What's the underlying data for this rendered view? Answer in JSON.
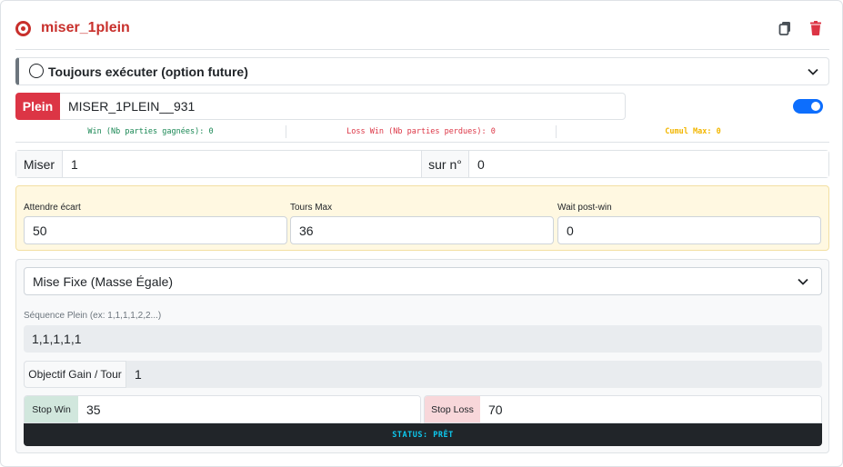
{
  "header": {
    "title": "miser_1plein",
    "title_color": "#c8302c"
  },
  "accordion": {
    "label": "Toujours exécuter (option future)"
  },
  "plein": {
    "badge_label": "Plein",
    "badge_color": "#dc3545",
    "value": "MISER_1PLEIN__931",
    "toggle_on": true
  },
  "stats": {
    "win": "Win (Nb parties gagnées): 0",
    "loss": "Loss Win (Nb parties perdues): 0",
    "cumul": "Cumul Max: 0"
  },
  "miser": {
    "label": "Miser",
    "value": "1",
    "sur_label": "sur n°",
    "sur_value": "0"
  },
  "params": {
    "attendre_label": "Attendre écart",
    "attendre_value": "50",
    "tours_label": "Tours Max",
    "tours_value": "36",
    "wait_label": "Wait post-win",
    "wait_value": "0"
  },
  "strategy": {
    "selected_option": "Mise Fixe (Masse Égale)",
    "sequence_label": "Séquence Plein (ex: 1,1,1,1,2,2...)",
    "sequence_value": "1,1,1,1,1",
    "objectif_label": "Objectif Gain / Tour",
    "objectif_value": "1",
    "stop_win_label": "Stop Win",
    "stop_win_value": "35",
    "stop_loss_label": "Stop Loss",
    "stop_loss_value": "70",
    "status": "STATUS: PRÊT"
  },
  "colors": {
    "toggle": "#0d6efd",
    "win": "#198754",
    "loss": "#dc3545",
    "cumul": "#f2b600",
    "status_text": "#0dcaf0",
    "status_bg": "#212529"
  },
  "icons": [
    "radio-icon",
    "copy-icon",
    "trash-icon",
    "chevron-down-icon"
  ]
}
